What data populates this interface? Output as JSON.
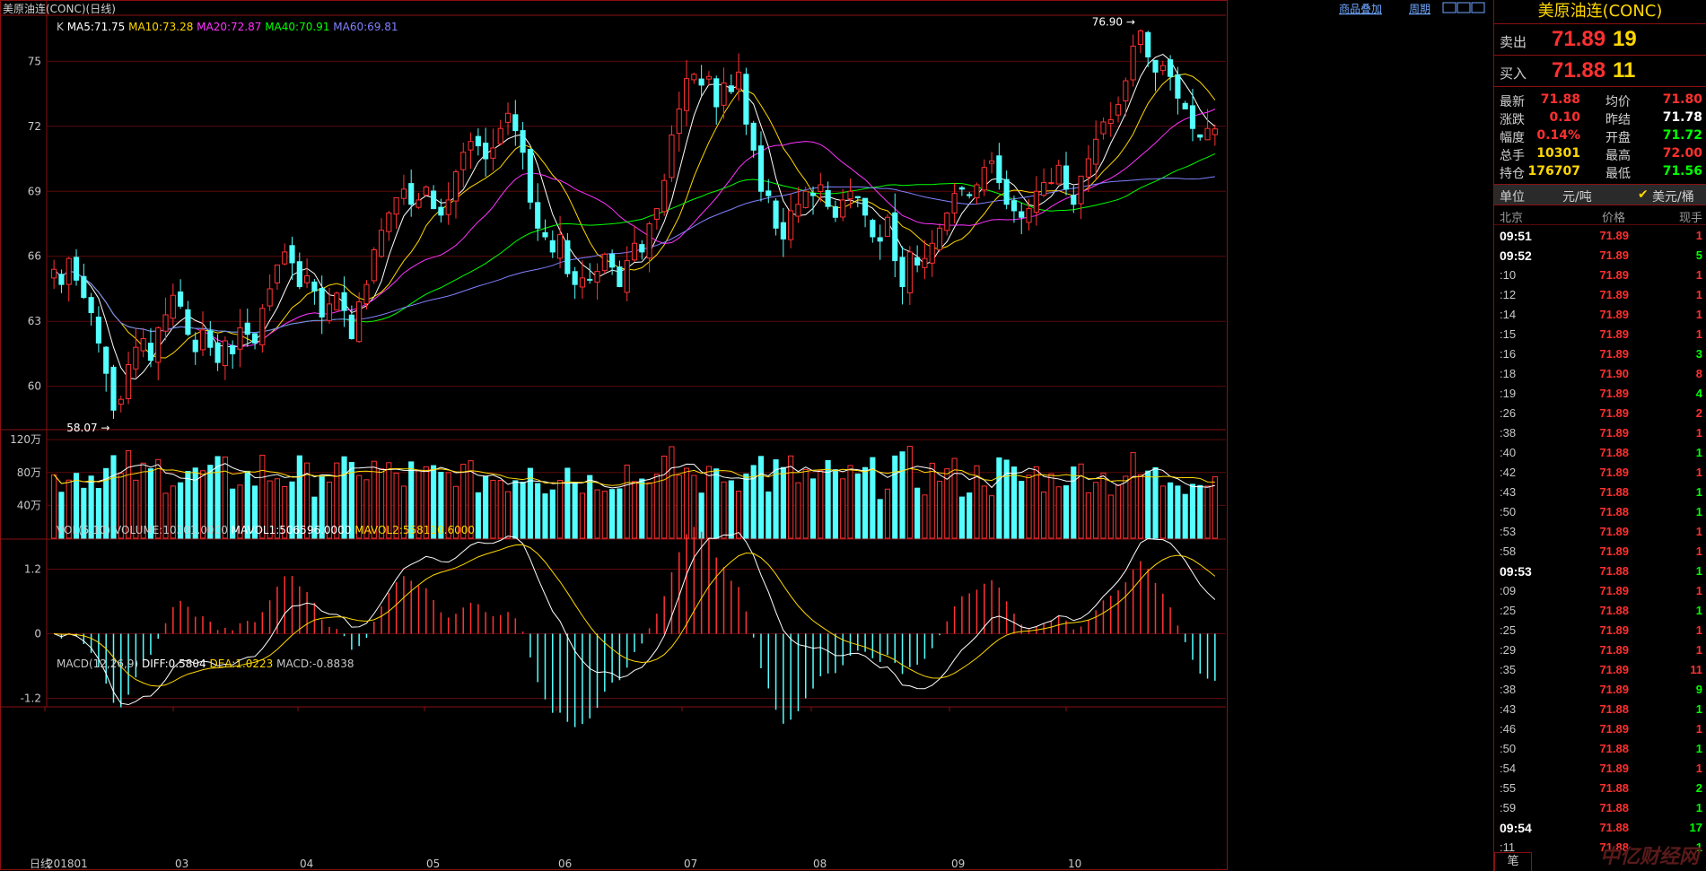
{
  "window": {
    "title": "美原油连(CONC)(日线)",
    "links": [
      "商品叠加",
      "周期"
    ]
  },
  "main_chart": {
    "ma_legend": {
      "prefix": "K",
      "items": [
        {
          "label": "MA5:71.75",
          "color": "#ffffff"
        },
        {
          "label": "MA10:73.28",
          "color": "#ffd700"
        },
        {
          "label": "MA20:72.87",
          "color": "#ff33ff"
        },
        {
          "label": "MA40:70.91",
          "color": "#00ff00"
        },
        {
          "label": "MA60:69.81",
          "color": "#8080ff"
        }
      ]
    },
    "y_ticks": [
      "75",
      "72",
      "69",
      "66",
      "63",
      "60"
    ],
    "high_label": "76.90",
    "low_label": "58.07"
  },
  "volume_chart": {
    "legend": {
      "items": [
        {
          "label": "VOL(5,10)",
          "color": "#c8c8c8"
        },
        {
          "label": "VOLUME:10301.0000",
          "color": "#c8c8c8"
        },
        {
          "label": "MAVOL1:506596.0000",
          "color": "#ffffff"
        },
        {
          "label": "MAVOL2:558110.6000",
          "color": "#ffd700"
        }
      ]
    },
    "y_ticks": [
      "120万",
      "80万",
      "40万"
    ]
  },
  "macd_chart": {
    "legend": {
      "items": [
        {
          "label": "MACD(12,26,9)",
          "color": "#c8c8c8"
        },
        {
          "label": "DIFF:0.5804",
          "color": "#ffffff"
        },
        {
          "label": "DEA:1.0223",
          "color": "#ffd700"
        },
        {
          "label": "MACD:-0.8838",
          "color": "#c8c8c8"
        }
      ]
    },
    "y_ticks": [
      "1.2",
      "0",
      "-1.2"
    ]
  },
  "x_axis": {
    "period_tab": "日线",
    "labels": [
      "201801",
      "03",
      "04",
      "05",
      "06",
      "07",
      "08",
      "09",
      "10"
    ]
  },
  "panel": {
    "title": "美原油连(CONC)",
    "sell": {
      "label": "卖出",
      "price": "71.89",
      "volume": "19"
    },
    "buy": {
      "label": "买入",
      "price": "71.88",
      "volume": "11"
    },
    "quotes": [
      {
        "l1": "最新",
        "v1": "71.88",
        "c1": "#ff3030",
        "l2": "均价",
        "v2": "71.80",
        "c2": "#ff3030"
      },
      {
        "l1": "涨跌",
        "v1": "0.10",
        "c1": "#ff3030",
        "l2": "昨结",
        "v2": "71.78",
        "c2": "#ffffff"
      },
      {
        "l1": "幅度",
        "v1": "0.14%",
        "c1": "#ff3030",
        "l2": "开盘",
        "v2": "71.72",
        "c2": "#00ff00"
      },
      {
        "l1": "总手",
        "v1": "10301",
        "c1": "#ffd700",
        "l2": "最高",
        "v2": "72.00",
        "c2": "#ff3030"
      },
      {
        "l1": "持仓",
        "v1": "176707",
        "c1": "#ffd700",
        "l2": "最低",
        "v2": "71.56",
        "c2": "#00ff00"
      }
    ],
    "unit": {
      "label": "单位",
      "option1": "元/吨",
      "option2": "美元/桶"
    },
    "ticks_header": {
      "time": "北京",
      "price": "价格",
      "volume": "现手"
    },
    "ticks": [
      {
        "time": "09:51",
        "full": true,
        "price": "71.89",
        "vol": "1",
        "vc": "#ff3030"
      },
      {
        "time": "09:52",
        "full": true,
        "price": "71.89",
        "vol": "5",
        "vc": "#00ff00"
      },
      {
        "time": ":10",
        "full": false,
        "price": "71.89",
        "vol": "1",
        "vc": "#ff3030"
      },
      {
        "time": ":12",
        "full": false,
        "price": "71.89",
        "vol": "1",
        "vc": "#ff3030"
      },
      {
        "time": ":14",
        "full": false,
        "price": "71.89",
        "vol": "1",
        "vc": "#ff3030"
      },
      {
        "time": ":15",
        "full": false,
        "price": "71.89",
        "vol": "1",
        "vc": "#ff3030"
      },
      {
        "time": ":16",
        "full": false,
        "price": "71.89",
        "vol": "3",
        "vc": "#00ff00"
      },
      {
        "time": ":18",
        "full": false,
        "price": "71.90",
        "vol": "8",
        "vc": "#ff3030"
      },
      {
        "time": ":19",
        "full": false,
        "price": "71.89",
        "vol": "4",
        "vc": "#00ff00"
      },
      {
        "time": ":26",
        "full": false,
        "price": "71.89",
        "vol": "2",
        "vc": "#ff3030"
      },
      {
        "time": ":38",
        "full": false,
        "price": "71.89",
        "vol": "1",
        "vc": "#ff3030"
      },
      {
        "time": ":40",
        "full": false,
        "price": "71.88",
        "vol": "1",
        "vc": "#00ff00"
      },
      {
        "time": ":42",
        "full": false,
        "price": "71.89",
        "vol": "1",
        "vc": "#ff3030"
      },
      {
        "time": ":43",
        "full": false,
        "price": "71.88",
        "vol": "1",
        "vc": "#00ff00"
      },
      {
        "time": ":50",
        "full": false,
        "price": "71.88",
        "vol": "1",
        "vc": "#00ff00"
      },
      {
        "time": ":53",
        "full": false,
        "price": "71.89",
        "vol": "1",
        "vc": "#ff3030"
      },
      {
        "time": ":58",
        "full": false,
        "price": "71.89",
        "vol": "1",
        "vc": "#ff3030"
      },
      {
        "time": "09:53",
        "full": true,
        "price": "71.88",
        "vol": "1",
        "vc": "#00ff00"
      },
      {
        "time": ":09",
        "full": false,
        "price": "71.89",
        "vol": "1",
        "vc": "#ff3030"
      },
      {
        "time": ":25",
        "full": false,
        "price": "71.88",
        "vol": "1",
        "vc": "#00ff00"
      },
      {
        "time": ":25",
        "full": false,
        "price": "71.89",
        "vol": "1",
        "vc": "#ff3030"
      },
      {
        "time": ":29",
        "full": false,
        "price": "71.89",
        "vol": "1",
        "vc": "#ff3030"
      },
      {
        "time": ":35",
        "full": false,
        "price": "71.89",
        "vol": "11",
        "vc": "#ff3030"
      },
      {
        "time": ":38",
        "full": false,
        "price": "71.89",
        "vol": "9",
        "vc": "#00ff00"
      },
      {
        "time": ":43",
        "full": false,
        "price": "71.88",
        "vol": "1",
        "vc": "#00ff00"
      },
      {
        "time": ":46",
        "full": false,
        "price": "71.89",
        "vol": "1",
        "vc": "#ff3030"
      },
      {
        "time": ":50",
        "full": false,
        "price": "71.88",
        "vol": "1",
        "vc": "#00ff00"
      },
      {
        "time": ":54",
        "full": false,
        "price": "71.89",
        "vol": "1",
        "vc": "#ff3030"
      },
      {
        "time": ":55",
        "full": false,
        "price": "71.88",
        "vol": "2",
        "vc": "#00ff00"
      },
      {
        "time": ":59",
        "full": false,
        "price": "71.88",
        "vol": "1",
        "vc": "#00ff00"
      },
      {
        "time": "09:54",
        "full": true,
        "price": "71.88",
        "vol": "17",
        "vc": "#00ff00"
      },
      {
        "time": ":11",
        "full": false,
        "price": "71.88",
        "vol": "1",
        "vc": "#00ff00"
      }
    ],
    "bottom_tab": "笔"
  },
  "chart_data": {
    "type": "candlestick",
    "ylim": [
      58,
      77
    ],
    "closes": [
      65.4,
      64.7,
      65.9,
      64.9,
      64.1,
      63.4,
      62.0,
      60.6,
      58.9,
      59.4,
      61.0,
      61.8,
      62.2,
      61.2,
      62.7,
      63.3,
      64.2,
      63.7,
      62.4,
      61.6,
      62.6,
      61.8,
      61.1,
      62.1,
      61.5,
      62.7,
      62.4,
      62.0,
      63.6,
      64.5,
      65.6,
      66.2,
      65.7,
      64.6,
      65.1,
      64.4,
      63.2,
      63.8,
      64.3,
      63.5,
      62.2,
      63.9,
      64.7,
      66.3,
      67.2,
      68.0,
      68.7,
      69.1,
      68.4,
      68.6,
      69.2,
      68.2,
      67.9,
      68.6,
      69.9,
      70.8,
      71.3,
      71.1,
      70.5,
      71.0,
      71.9,
      72.6,
      71.8,
      70.8,
      68.5,
      67.3,
      66.9,
      66.2,
      67.0,
      65.2,
      64.7,
      65.0,
      64.9,
      65.3,
      66.1,
      65.5,
      64.6,
      65.8,
      66.6,
      66.2,
      67.5,
      68.2,
      69.5,
      71.6,
      72.8,
      74.2,
      74.4,
      73.9,
      74.3,
      72.9,
      74.0,
      73.6,
      74.5,
      72.1,
      70.9,
      69.0,
      68.8,
      67.3,
      66.8,
      68.1,
      68.4,
      69.0,
      68.8,
      69.3,
      68.3,
      67.8,
      68.6,
      69.0,
      68.7,
      67.9,
      66.9,
      66.7,
      67.8,
      65.8,
      64.6,
      66.2,
      65.6,
      65.9,
      66.6,
      67.3,
      68.0,
      68.9,
      69.1,
      68.8,
      69.3,
      70.1,
      70.4,
      69.4,
      68.4,
      68.1,
      67.8,
      68.2,
      69.0,
      69.4,
      69.4,
      70.2,
      69.1,
      68.4,
      69.7,
      70.5,
      71.4,
      72.2,
      72.3,
      73.0,
      74.1,
      75.7,
      76.4,
      75.2,
      74.5,
      74.8,
      74.3,
      73.3,
      72.8,
      71.9,
      71.5,
      71.9,
      71.88
    ],
    "ma_series": [
      "MA5",
      "MA10",
      "MA20",
      "MA40",
      "MA60"
    ]
  }
}
